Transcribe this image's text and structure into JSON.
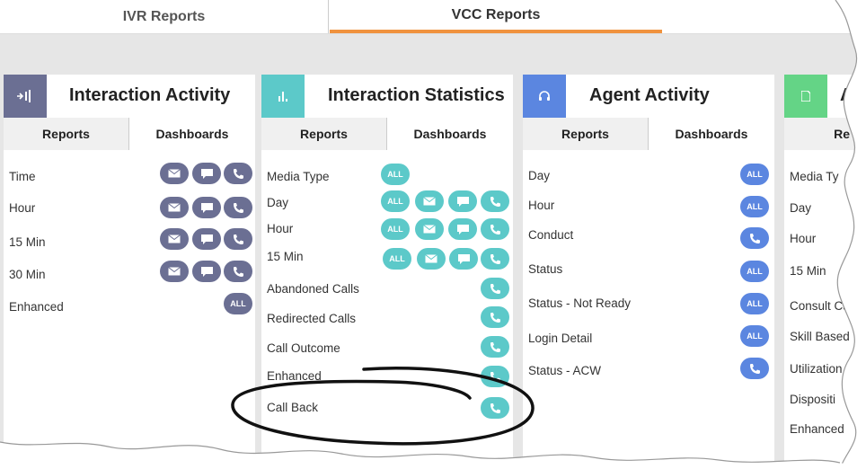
{
  "top_tabs": {
    "ivr": "IVR Reports",
    "vcc": "VCC Reports"
  },
  "cards": [
    {
      "title": "Interaction Activity",
      "icon": "interaction-activity-icon",
      "tabs": {
        "reports": "Reports",
        "dashboards": "Dashboards"
      },
      "rows": [
        "Time",
        "Hour",
        "15 Min",
        "30 Min",
        "Enhanced"
      ],
      "all_label": "ALL"
    },
    {
      "title": "Interaction Statistics",
      "icon": "bar-chart-icon",
      "tabs": {
        "reports": "Reports",
        "dashboards": "Dashboards"
      },
      "rows": [
        "Media Type",
        "Day",
        "Hour",
        "15 Min",
        "Abandoned Calls",
        "Redirected Calls",
        "Call Outcome",
        "Enhanced",
        "Call Back"
      ],
      "all_label": "ALL"
    },
    {
      "title": "Agent Activity",
      "icon": "headset-icon",
      "tabs": {
        "reports": "Reports",
        "dashboards": "Dashboards"
      },
      "rows": [
        "Day",
        "Hour",
        "Conduct",
        "Status",
        "Status - Not Ready",
        "Login Detail",
        "Status - ACW"
      ],
      "all_label": "ALL"
    },
    {
      "title": "A",
      "icon": "document-icon",
      "tabs": {
        "reports": "Re"
      },
      "rows": [
        "Media Ty",
        "Day",
        "Hour",
        "15 Min",
        "Consult Calls",
        "Skill Based",
        "Utilization",
        "Dispositi",
        "Enhanced"
      ]
    }
  ],
  "colors": {
    "navy": "#6b6f93",
    "teal": "#5cc9c9",
    "blue": "#5b86e0",
    "green": "#64d486",
    "orange": "#f0923e"
  }
}
